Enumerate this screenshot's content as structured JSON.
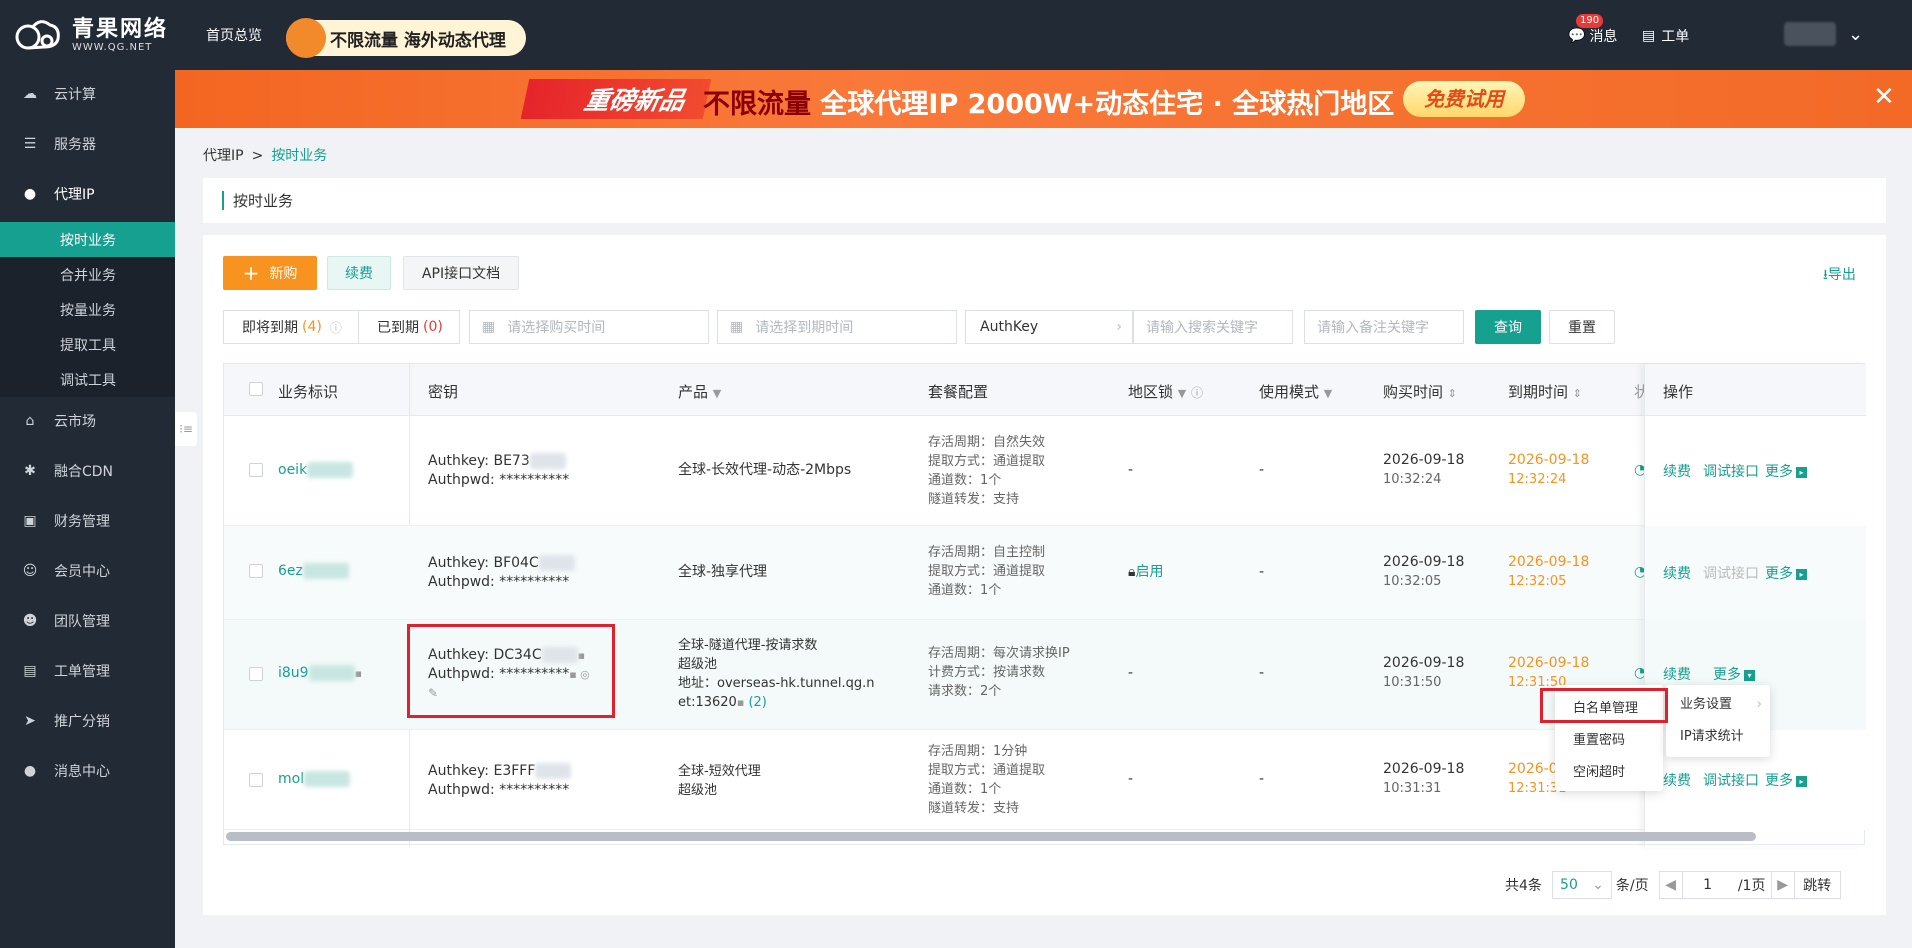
{
  "topbar": {
    "brand_name": "青果网络",
    "brand_url": "WWW.QG.NET",
    "home_link": "首页总览",
    "promo_pill": "不限流量 海外动态代理",
    "messages_label": "消息",
    "messages_badge": "190",
    "tickets_label": "工单"
  },
  "sidebar": {
    "items": [
      {
        "label": "云计算",
        "icon": "cloud-icon"
      },
      {
        "label": "服务器",
        "icon": "server-icon"
      },
      {
        "label": "代理IP",
        "icon": "location-pin-icon"
      },
      {
        "label": "云市场",
        "icon": "store-icon"
      },
      {
        "label": "融合CDN",
        "icon": "cdn-icon"
      },
      {
        "label": "财务管理",
        "icon": "finance-icon"
      },
      {
        "label": "会员中心",
        "icon": "member-icon"
      },
      {
        "label": "团队管理",
        "icon": "team-icon"
      },
      {
        "label": "工单管理",
        "icon": "ticket-icon"
      },
      {
        "label": "推广分销",
        "icon": "send-icon"
      },
      {
        "label": "消息中心",
        "icon": "chat-icon"
      }
    ],
    "sub_items": [
      {
        "label": "按时业务",
        "active": true
      },
      {
        "label": "合并业务",
        "active": false
      },
      {
        "label": "按量业务",
        "active": false
      },
      {
        "label": "提取工具",
        "active": false
      },
      {
        "label": "调试工具",
        "active": false
      }
    ]
  },
  "banner": {
    "tag": "重磅新品",
    "headline_a": "不限流量",
    "headline_b": " 全球代理IP 2000W+动态住宅 · 全球热门地区",
    "cta": "免费试用"
  },
  "breadcrumb": {
    "parent": "代理IP",
    "separator": ">",
    "current": "按时业务"
  },
  "page_title": "按时业务",
  "toolbar": {
    "new_label": "新购",
    "renew_label": "续费",
    "api_doc_label": "API接口文档",
    "export_label": "导出"
  },
  "filters": {
    "expiring_label": "即将到期",
    "expiring_count": "(4)",
    "expired_label": "已到期",
    "expired_count": "(0)",
    "buy_date_placeholder": "请选择购买时间",
    "end_date_placeholder": "请选择到期时间",
    "authkey_select": "AuthKey",
    "keyword_placeholder": "请输入搜索关键字",
    "remark_placeholder": "请输入备注关键字",
    "query_label": "查询",
    "reset_label": "重置"
  },
  "table": {
    "headers": {
      "id": "业务标识",
      "secret": "密钥",
      "product": "产品",
      "plan": "套餐配置",
      "region_lock": "地区锁",
      "mode": "使用模式",
      "buy_time": "购买时间",
      "end_time": "到期时间",
      "status_partial": "状",
      "ops": "操作"
    },
    "rows": [
      {
        "id": "oeik",
        "authkey": "Authkey:  BE73",
        "authpwd": "Authpwd:  **********",
        "product_lines": [
          "全球-长效代理-动态-2Mbps"
        ],
        "plan_lines": [
          "存活周期：自然失效",
          "提取方式：通道提取",
          "通道数：1个",
          "隧道转发：支持"
        ],
        "region_lock": "-",
        "mode": "-",
        "buy_date": "2026-09-18",
        "buy_time": "10:32:24",
        "end_date": "2026-09-18",
        "end_time": "12:32:24",
        "ops": {
          "renew": "续费",
          "debug": "调试接口",
          "more": "更多",
          "debug_disabled": false
        }
      },
      {
        "id": "6ez",
        "authkey": "Authkey:  BF04C",
        "authpwd": "Authpwd:  **********",
        "product_lines": [
          "全球-独享代理"
        ],
        "plan_lines": [
          "存活周期：自主控制",
          "提取方式：通道提取",
          "通道数：1个"
        ],
        "region_lock": "启用",
        "mode": "-",
        "buy_date": "2026-09-18",
        "buy_time": "10:32:05",
        "end_date": "2026-09-18",
        "end_time": "12:32:05",
        "ops": {
          "renew": "续费",
          "debug": "调试接口",
          "more": "更多",
          "debug_disabled": true
        }
      },
      {
        "id": "i8u9",
        "authkey": "Authkey:  DC34C",
        "authpwd": "Authpwd:  **********",
        "product_lines": [
          "全球-隧道代理-按请求数",
          "超级池",
          "地址：overseas-hk.tunnel.qg.n",
          "et:13620"
        ],
        "product_extra": "(2)",
        "plan_lines": [
          "存活周期：每次请求换IP",
          "计费方式：按请求数",
          "请求数：2个"
        ],
        "region_lock": "-",
        "mode": "-",
        "buy_date": "2026-09-18",
        "buy_time": "10:31:50",
        "end_date": "2026-09-18",
        "end_time": "12:31:50",
        "ops": {
          "renew": "续费",
          "more": "更多"
        }
      },
      {
        "id": "mol",
        "authkey": "Authkey:  E3FFF",
        "authpwd": "Authpwd:  **********",
        "product_lines": [
          "全球-短效代理",
          "超级池"
        ],
        "plan_lines": [
          "存活周期：1分钟",
          "提取方式：通道提取",
          "通道数：1个",
          "隧道转发：支持"
        ],
        "region_lock": "-",
        "mode": "-",
        "buy_date": "2026-09-18",
        "buy_time": "10:31:31",
        "end_date": "2026-0",
        "end_time": "12:31:31",
        "ops": {
          "renew": "续费",
          "debug": "调试接口",
          "more": "更多",
          "debug_disabled": false
        }
      }
    ]
  },
  "more_menu": {
    "left": [
      "白名单管理",
      "重置密码",
      "空闲超时"
    ],
    "right": [
      "业务设置",
      "IP请求统计"
    ]
  },
  "pagination": {
    "total": "共4条",
    "page_size": "50",
    "per_page": "条/页",
    "current": "1",
    "pages": "/1页",
    "jump": "跳转"
  },
  "colors": {
    "accent": "#16a090",
    "orange": "#f7931e",
    "highlight": "#e0202c",
    "sidebar": "#222a36"
  }
}
